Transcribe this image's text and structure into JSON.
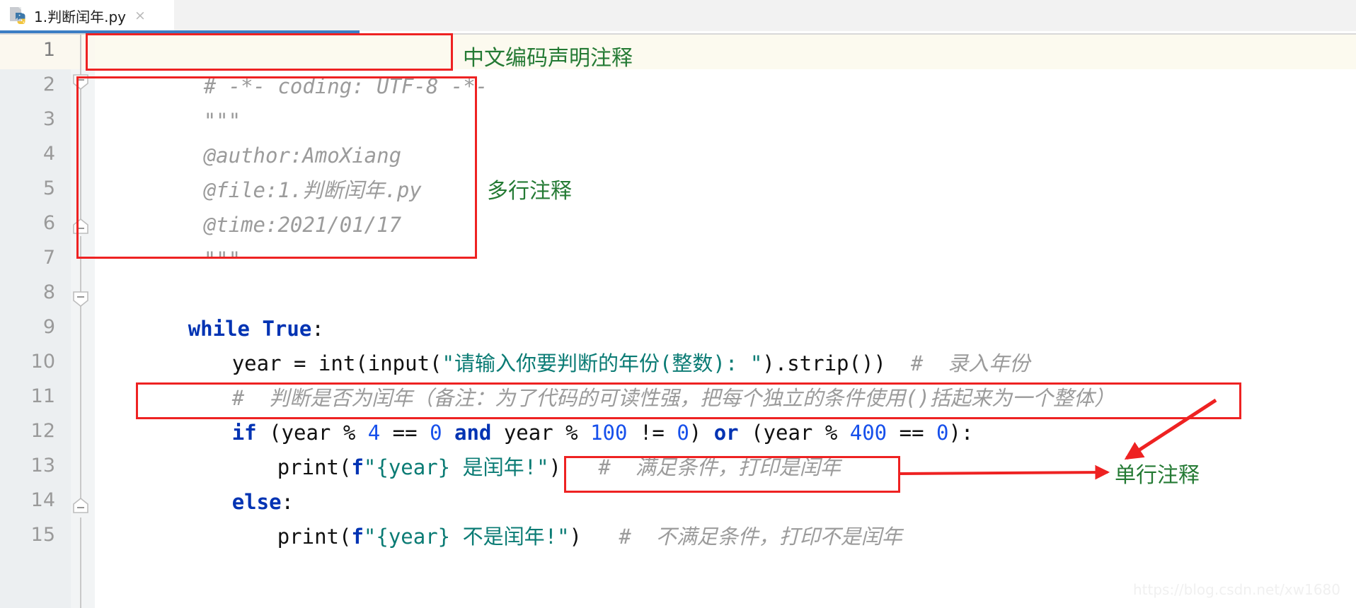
{
  "tab": {
    "label": "1.判断闰年.py",
    "close_label": "×",
    "icon": "python-file-icon"
  },
  "gutter": {
    "line_numbers": [
      "1",
      "2",
      "3",
      "4",
      "5",
      "6",
      "7",
      "8",
      "9",
      "10",
      "11",
      "12",
      "13",
      "14",
      "15"
    ],
    "fold_lines": [
      2,
      6,
      8,
      14
    ]
  },
  "code": {
    "line1": {
      "comment": "# -*- coding: UTF-8 -*-"
    },
    "line2": {
      "text": "\"\"\""
    },
    "line3": {
      "text": "@author:AmoXiang"
    },
    "line4": {
      "text": "@file:1.判断闰年.py"
    },
    "line5": {
      "text": "@time:2021/01/17"
    },
    "line6": {
      "text": "\"\"\""
    },
    "line7": {
      "text": ""
    },
    "line8": {
      "kw_while": "while",
      "kw_true": "True",
      "colon": ":"
    },
    "line9": {
      "var": "year = ",
      "call": "int(input(",
      "string": "\"请输入你要判断的年份(整数): \"",
      "tail": ").strip())",
      "comment": "#  录入年份"
    },
    "line10": {
      "comment": "#  判断是否为闰年（备注：为了代码的可读性强，把每个独立的条件使用()括起来为一个整体）"
    },
    "line11": {
      "kw_if": "if",
      "p1": " (year % ",
      "n4": "4",
      "p2": " == ",
      "n0a": "0",
      "kw_and": "and",
      "p3": " year % ",
      "n100": "100",
      "p4": " != ",
      "n0b": "0",
      "p5": ") ",
      "kw_or": "or",
      "p6": " (year % ",
      "n400": "400",
      "p7": " == ",
      "n0c": "0",
      "p8": "):"
    },
    "line12": {
      "fn": "print(",
      "fprefix": "f",
      "str_open": "\"{year} ",
      "str_cn": "是闰年!\"",
      "close": ")",
      "comment": "#  满足条件，打印是闰年"
    },
    "line13": {
      "kw_else": "else",
      "colon": ":"
    },
    "line14": {
      "fn": "print(",
      "fprefix": "f",
      "str_open": "\"{year} ",
      "str_cn": "不是闰年!\"",
      "close": ")",
      "comment": "#  不满足条件，打印不是闰年"
    },
    "line15": {
      "text": ""
    }
  },
  "annotations": {
    "encoding_note": "中文编码声明注释",
    "multiline_note": "多行注释",
    "singleline_note": "单行注释"
  },
  "watermark": "https://blog.csdn.net/xw1680",
  "colors": {
    "annotation_red": "#ee2222",
    "annotation_green": "#247a34",
    "keyword_blue": "#0033b3",
    "number_blue": "#1750eb",
    "string_teal": "#0a7b74",
    "comment_grey": "#9b9b9b",
    "tab_accent": "#3b7dc4",
    "current_line": "#fcfaef"
  }
}
